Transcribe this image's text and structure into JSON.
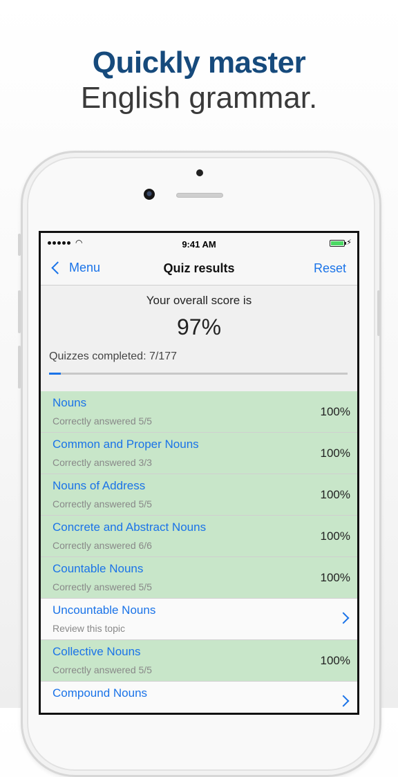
{
  "headline": {
    "line1": "Quickly master",
    "line2": "English grammar."
  },
  "status": {
    "time": "9:41 AM"
  },
  "nav": {
    "back_label": "Menu",
    "title": "Quiz results",
    "reset_label": "Reset"
  },
  "summary": {
    "score_label": "Your overall score is",
    "score": "97%",
    "completed": "Quizzes completed: 7/177",
    "progress_fraction": 0.0395
  },
  "topics": [
    {
      "title": "Nouns",
      "subtitle": "Correctly answered 5/5",
      "percent": "100%"
    },
    {
      "title": "Common and Proper Nouns",
      "subtitle": "Correctly answered 3/3",
      "percent": "100%"
    },
    {
      "title": "Nouns of Address",
      "subtitle": "Correctly answered 5/5",
      "percent": "100%"
    },
    {
      "title": "Concrete and Abstract Nouns",
      "subtitle": "Correctly answered 6/6",
      "percent": "100%"
    },
    {
      "title": "Countable Nouns",
      "subtitle": "Correctly answered 5/5",
      "percent": "100%"
    },
    {
      "title": "Uncountable Nouns",
      "subtitle": "Review this topic",
      "percent": ""
    },
    {
      "title": "Collective Nouns",
      "subtitle": "Correctly answered 5/5",
      "percent": "100%"
    },
    {
      "title": "Compound Nouns",
      "subtitle": "",
      "percent": ""
    }
  ],
  "colors": {
    "accent": "#1a73e8",
    "completed_row": "#c8e6c9",
    "headline": "#164a7c"
  }
}
